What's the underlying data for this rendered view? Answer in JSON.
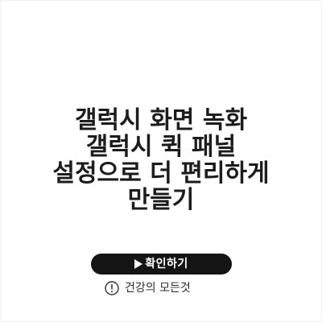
{
  "title": {
    "lines": [
      "갤럭시 화면 녹화",
      "갤럭시 퀵 패널",
      "설정으로 더 편리하게",
      "만들기"
    ]
  },
  "confirm_button": {
    "label": "확인하기",
    "icon": "play-icon"
  },
  "notice": {
    "label": "건강의 모든것",
    "icon": "exclamation-circle-icon"
  },
  "colors": {
    "background": "#ffffff",
    "title_text": "#1c1c1c",
    "button_background": "#141414",
    "button_text": "#ffffff",
    "notice_text": "#2a2a2a"
  }
}
